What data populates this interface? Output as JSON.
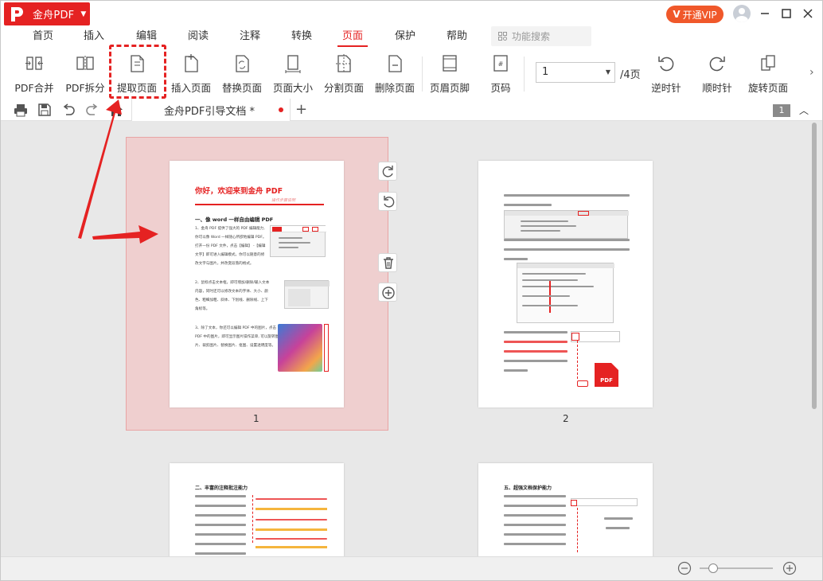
{
  "app": {
    "name": "金舟PDF",
    "vip_label": "开通VIP"
  },
  "menu": {
    "items": [
      "首页",
      "插入",
      "编辑",
      "阅读",
      "注释",
      "转换",
      "页面",
      "保护",
      "帮助"
    ],
    "active": "页面",
    "search_placeholder": "功能搜索"
  },
  "toolbar": {
    "tools": [
      "PDF合并",
      "PDF拆分",
      "提取页面",
      "插入页面",
      "替换页面",
      "页面大小",
      "分割页面",
      "删除页面",
      "页眉页脚",
      "页码"
    ],
    "page_input": "1",
    "page_total": "/4页",
    "rotate": [
      "逆时针",
      "顺时针",
      "旋转页面"
    ]
  },
  "tabs": {
    "doc_title": "金舟PDF引导文档 *",
    "page_indicator": "1"
  },
  "pages": {
    "labels": [
      "1",
      "2"
    ],
    "page1": {
      "title": "你好，欢迎来到金舟 PDF",
      "subtitle": "操作步骤说明",
      "section1": "一、像 word 一样自由编辑 PDF",
      "p1": [
        "1、金舟 PDF 提供了强大的 PDF 编辑能力,",
        "你可以像 Word 一样随心所欲地编辑 PDF。",
        "打开一份 PDF 文件，点击【编辑】 -【编辑",
        "文字】即可进入编辑模式，你可以随意的修",
        "改文字与图片，并改变段落的格式。"
      ],
      "p2": [
        "2、鼠标点击文本框，即可增加/删除/输入文本",
        "内容，同时还可以修改文本的字体、大小、颜",
        "色、粗细加粗、斜体、下划线、删除线、上下",
        "角标等。"
      ],
      "p3": [
        "3、除了文本，你还可以编辑 PDF 中的图片，点击",
        "PDF 中的图片，即可显示图片操作菜单, 可以旋转图",
        "片、裁剪图片、替换图片、抠图、设置透明度等。"
      ]
    },
    "page3": {
      "section": "二、丰富的注释批注能力"
    },
    "page4": {
      "section": "五、超强文档保护能力"
    },
    "page2": {
      "pdf_label": "PDF"
    }
  },
  "colors": {
    "brand": "#e52222",
    "vip": "#f0582a",
    "selection": "#efcfcf"
  },
  "icons": [
    "home-icon",
    "print-icon",
    "save-icon",
    "undo-icon",
    "redo-icon",
    "rotate-cw-icon",
    "rotate-ccw-icon",
    "trash-icon",
    "plus-icon",
    "zoom-out-icon",
    "zoom-in-icon"
  ]
}
